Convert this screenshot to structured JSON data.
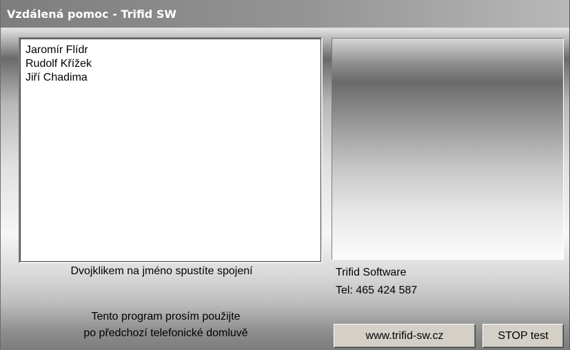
{
  "window": {
    "title": "Vzdálená pomoc - Trifid SW"
  },
  "contacts": {
    "items": [
      {
        "label": "Jaromír Flídr"
      },
      {
        "label": "Rudolf Křížek"
      },
      {
        "label": "Jiří Chadima"
      }
    ],
    "hint": "Dvojklikem na jméno spustíte spojení"
  },
  "company": {
    "name": "Trifid Software",
    "phone": "Tel: 465 424 587"
  },
  "note": {
    "line1": "Tento program prosím použijte",
    "line2": "po předchozí telefonické domluvě"
  },
  "buttons": {
    "website": "www.trifid-sw.cz",
    "stop_test": "STOP test"
  }
}
